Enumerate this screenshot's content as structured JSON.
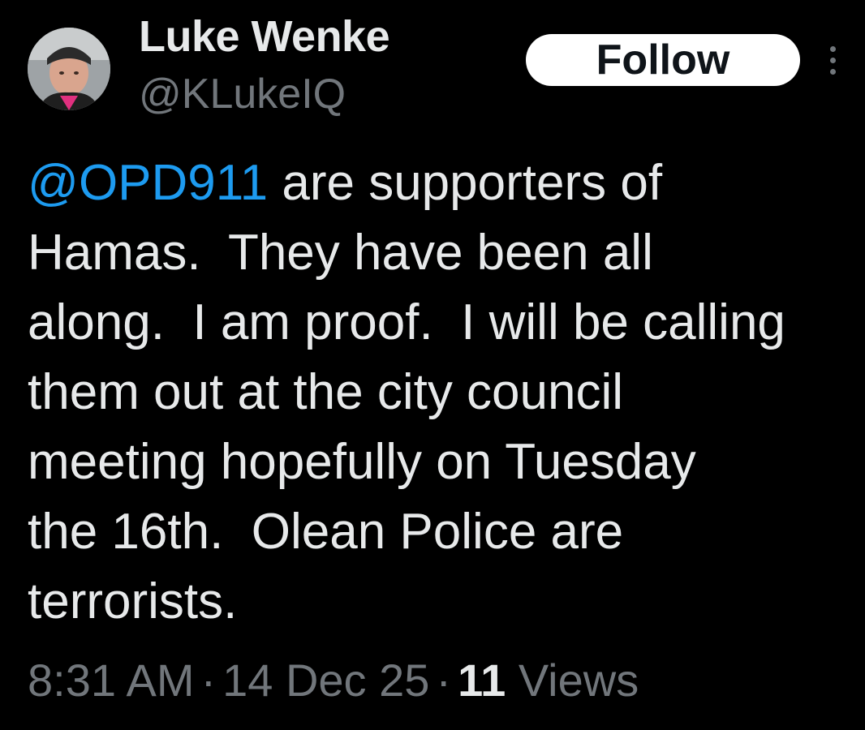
{
  "author": {
    "display_name": "Luke Wenke",
    "handle": "@KLukeIQ",
    "avatar_icon": "profile-photo"
  },
  "actions": {
    "follow_label": "Follow",
    "more_icon": "more-vertical-icon"
  },
  "tweet": {
    "mention": "@OPD911",
    "lines": [
      " are supporters of",
      "Hamas.  They have been all",
      "along.  I am proof.  I will be calling",
      "them out at the city council",
      "meeting hopefully on Tuesday",
      "the 16th.  Olean Police are",
      "terrorists."
    ]
  },
  "meta": {
    "time": "8:31 AM",
    "separator": "·",
    "date": "14 Dec 25",
    "views_count": "11",
    "views_label": "Views"
  },
  "colors": {
    "background": "#000000",
    "text": "#e7e9ea",
    "secondary": "#71767b",
    "accent": "#1d9bf0",
    "follow_bg": "#ffffff"
  }
}
